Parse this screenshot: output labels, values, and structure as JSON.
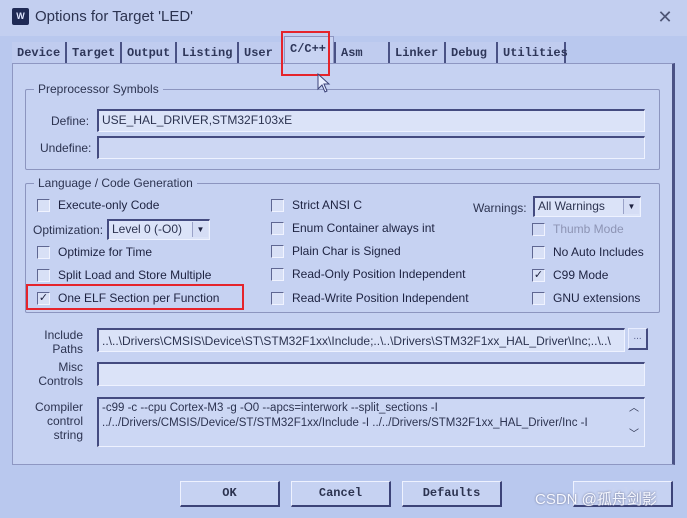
{
  "window": {
    "title": "Options for Target 'LED'",
    "icon": "keil-uvision-icon",
    "close_glyph": "✕"
  },
  "tabs": [
    {
      "label": "Device",
      "active": false
    },
    {
      "label": "Target",
      "active": false
    },
    {
      "label": "Output",
      "active": false
    },
    {
      "label": "Listing",
      "active": false
    },
    {
      "label": "User",
      "active": false
    },
    {
      "label": "C/C++",
      "active": true
    },
    {
      "label": "Asm",
      "active": false
    },
    {
      "label": "Linker",
      "active": false
    },
    {
      "label": "Debug",
      "active": false
    },
    {
      "label": "Utilities",
      "active": false
    }
  ],
  "preprocessor": {
    "legend": "Preprocessor Symbols",
    "define_label": "Define:",
    "define_value": "USE_HAL_DRIVER,STM32F103xE",
    "undefine_label": "Undefine:",
    "undefine_value": ""
  },
  "language": {
    "legend": "Language / Code Generation",
    "execute_only": {
      "label": "Execute-only Code",
      "checked": false
    },
    "optimization_label": "Optimization:",
    "optimization_value": "Level 0 (-O0)",
    "optimize_time": {
      "label": "Optimize for Time",
      "checked": false
    },
    "split_load": {
      "label": "Split Load and Store Multiple",
      "checked": false
    },
    "one_elf": {
      "label": "One ELF Section per Function",
      "checked": true
    },
    "strict_ansi": {
      "label": "Strict ANSI C",
      "checked": false
    },
    "enum_container": {
      "label": "Enum Container always int",
      "checked": false
    },
    "plain_char": {
      "label": "Plain Char is Signed",
      "checked": false
    },
    "ro_pi": {
      "label": "Read-Only Position Independent",
      "checked": false
    },
    "rw_pi": {
      "label": "Read-Write Position Independent",
      "checked": false
    },
    "warnings_label": "Warnings:",
    "warnings_value": "All Warnings",
    "thumb_mode": {
      "label": "Thumb Mode",
      "checked": false,
      "disabled": true
    },
    "no_auto_includes": {
      "label": "No Auto Includes",
      "checked": false
    },
    "c99_mode": {
      "label": "C99 Mode",
      "checked": true
    },
    "gnu_ext": {
      "label": "GNU extensions",
      "checked": false
    }
  },
  "paths": {
    "include_label_1": "Include",
    "include_label_2": "Paths",
    "include_value": "..\\..\\Drivers\\CMSIS\\Device\\ST\\STM32F1xx\\Include;..\\..\\Drivers\\STM32F1xx_HAL_Driver\\Inc;..\\..\\",
    "browse_label": "...",
    "misc_label_1": "Misc",
    "misc_label_2": "Controls",
    "misc_value": "",
    "compiler_label_1": "Compiler",
    "compiler_label_2": "control",
    "compiler_label_3": "string",
    "compiler_line_1": "-c99 -c --cpu Cortex-M3 -g -O0 --apcs=interwork --split_sections -I",
    "compiler_line_2": "../../Drivers/CMSIS/Device/ST/STM32F1xx/Include -I ../../Drivers/STM32F1xx_HAL_Driver/Inc -I"
  },
  "buttons": {
    "ok": "OK",
    "cancel": "Cancel",
    "defaults": "Defaults",
    "help": "Help"
  },
  "watermark": "CSDN @孤舟剑影",
  "annotation_color": "#e5242b"
}
